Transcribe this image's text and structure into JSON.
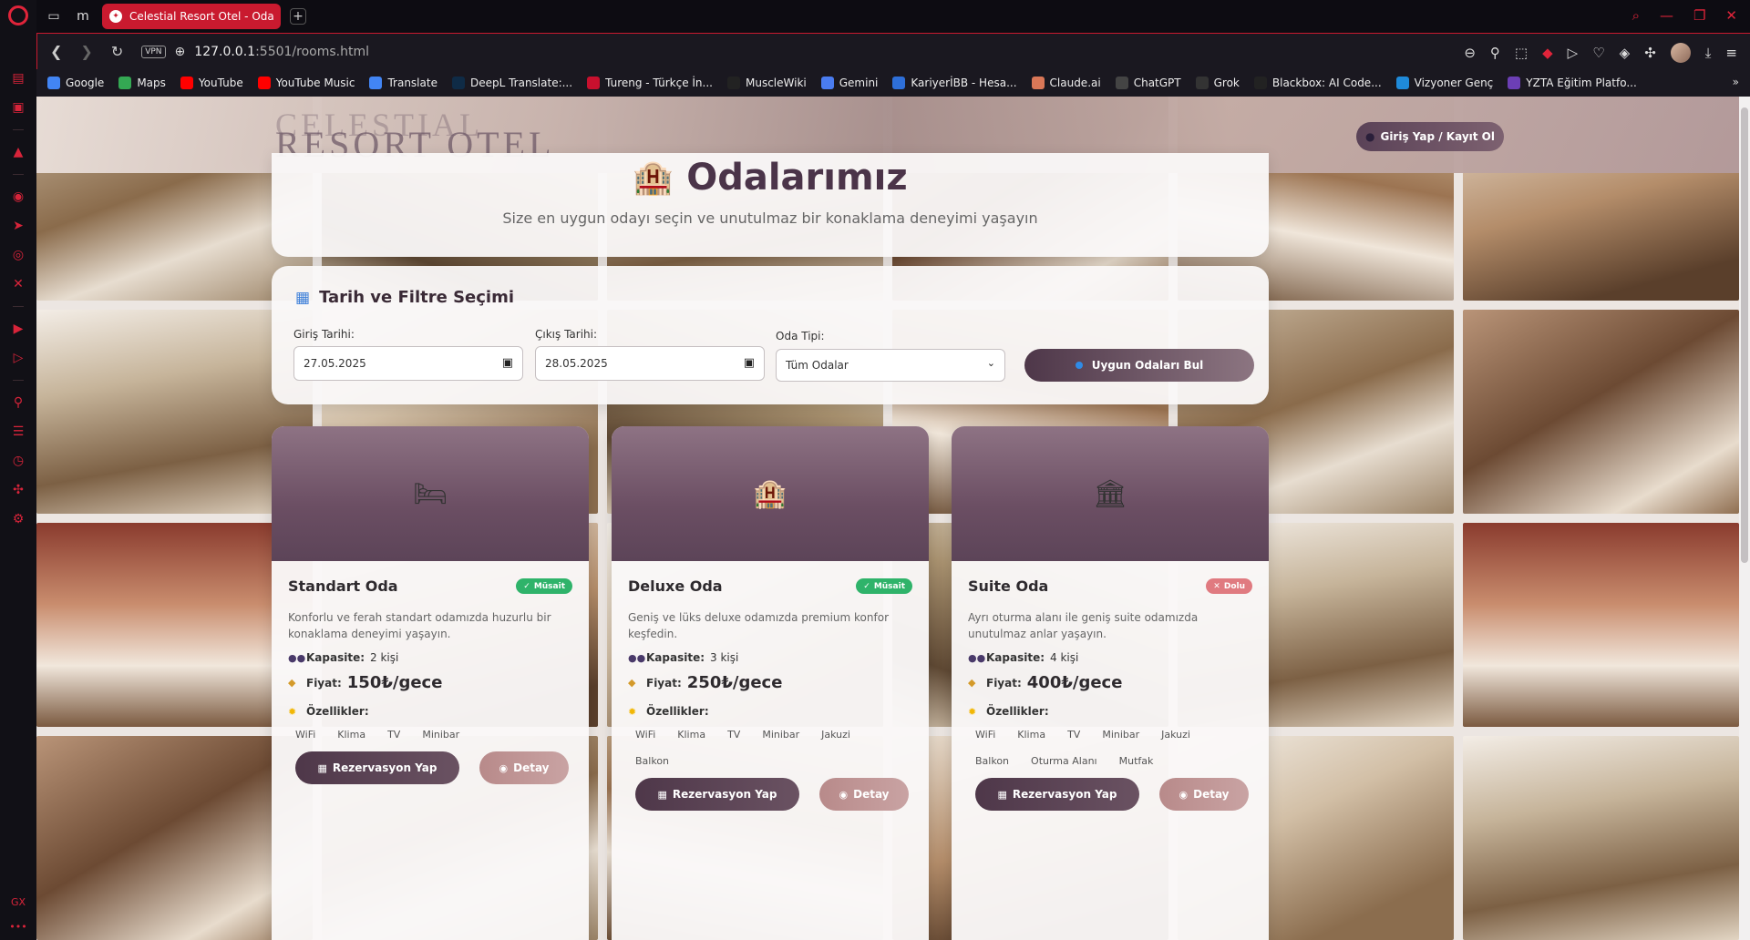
{
  "browser": {
    "tab_title": "Celestial Resort Otel - Oda",
    "url_host": "127.0.0.1",
    "url_rest": ":5501/rooms.html",
    "vpn_label": "VPN",
    "bookmarks": [
      {
        "label": "Google",
        "color": "#4285f4"
      },
      {
        "label": "Maps",
        "color": "#34a853"
      },
      {
        "label": "YouTube",
        "color": "#ff0000"
      },
      {
        "label": "YouTube Music",
        "color": "#ff0000"
      },
      {
        "label": "Translate",
        "color": "#4285f4"
      },
      {
        "label": "DeepL Translate:...",
        "color": "#0f2b46"
      },
      {
        "label": "Tureng - Türkçe İn...",
        "color": "#c8102e"
      },
      {
        "label": "MuscleWiki",
        "color": "#222222"
      },
      {
        "label": "Gemini",
        "color": "#4a7cf0"
      },
      {
        "label": "KariyerİBB - Hesa...",
        "color": "#2e6fd8"
      },
      {
        "label": "Claude.ai",
        "color": "#d97757"
      },
      {
        "label": "ChatGPT",
        "color": "#444444"
      },
      {
        "label": "Grok",
        "color": "#333333"
      },
      {
        "label": "Blackbox: AI Code...",
        "color": "#222222"
      },
      {
        "label": "Vizyoner Genç",
        "color": "#1f8ad9"
      },
      {
        "label": "YZTA Eğitim Platfo...",
        "color": "#6c3fb5"
      }
    ]
  },
  "header": {
    "brand_line1": "CELESTIAL",
    "brand_line2": "RESORT OTEL",
    "login_label": "Giriş Yap / Kayıt Ol"
  },
  "hero": {
    "title": "Odalarımız",
    "subtitle": "Size en uygun odayı seçin ve unutulmaz bir konaklama deneyimi yaşayın"
  },
  "filter": {
    "title": "Tarih ve Filtre Seçimi",
    "checkin_label": "Giriş Tarihi:",
    "checkin_value": "27.05.2025",
    "checkout_label": "Çıkış Tarihi:",
    "checkout_value": "28.05.2025",
    "room_type_label": "Oda Tipi:",
    "room_type_value": "Tüm Odalar",
    "search_label": "Uygun Odaları Bul"
  },
  "labels": {
    "capacity": "Kapasite:",
    "price": "Fiyat:",
    "features": "Özellikler:",
    "reserve": "Rezervasyon Yap",
    "detail": "Detay"
  },
  "rooms": [
    {
      "name": "Standart Oda",
      "status": "Müsait",
      "status_type": "ok",
      "description": "Konforlu ve ferah standart odamızda huzurlu bir konaklama deneyimi yaşayın.",
      "capacity": "2 kişi",
      "price": "150₺/gece",
      "features": [
        "WiFi",
        "Klima",
        "TV",
        "Minibar"
      ],
      "icon": "bed-icon"
    },
    {
      "name": "Deluxe Oda",
      "status": "Müsait",
      "status_type": "ok",
      "description": "Geniş ve lüks deluxe odamızda premium konfor keşfedin.",
      "capacity": "3 kişi",
      "price": "250₺/gece",
      "features": [
        "WiFi",
        "Klima",
        "TV",
        "Minibar",
        "Jakuzi",
        "Balkon"
      ],
      "icon": "hotel-icon"
    },
    {
      "name": "Suite Oda",
      "status": "Dolu",
      "status_type": "full",
      "description": "Ayrı oturma alanı ile geniş suite odamızda unutulmaz anlar yaşayın.",
      "capacity": "4 kişi",
      "price": "400₺/gece",
      "features": [
        "WiFi",
        "Klima",
        "TV",
        "Minibar",
        "Jakuzi",
        "Balkon",
        "Oturma Alanı",
        "Mutfak"
      ],
      "icon": "classical-building-icon"
    }
  ]
}
